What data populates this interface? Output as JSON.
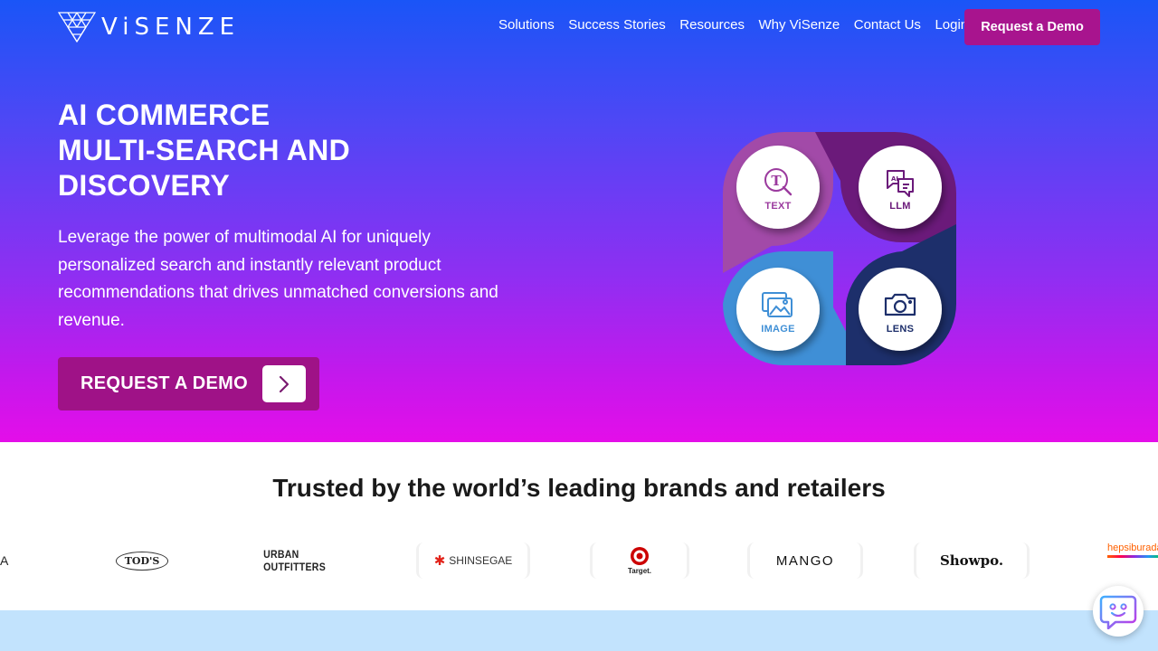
{
  "brand": {
    "name": "ViSENZE"
  },
  "nav": {
    "links": [
      "Solutions",
      "Success Stories",
      "Resources",
      "Why ViSenze",
      "Contact Us",
      "Login"
    ],
    "cta_label": "Request a Demo"
  },
  "hero": {
    "title_lines": [
      "AI COMMERCE",
      "MULTI-SEARCH AND",
      "DISCOVERY"
    ],
    "description": "Leverage the power of multimodal AI for uniquely personalized search and instantly relevant product recommendations that drives unmatched conversions and revenue.",
    "button_label": "REQUEST A DEMO"
  },
  "graphic": {
    "labels": {
      "text": "TEXT",
      "llm": "LLM",
      "image": "IMAGE",
      "lens": "LENS"
    }
  },
  "trusted": {
    "heading": "Trusted by the world’s leading brands and retailers",
    "brands": {
      "partial_left": "A",
      "tods": "TOD'S",
      "urban": "URBAN OUTFITTERS",
      "shinsegae": "SHINSEGAE",
      "target": "Target.",
      "mango": "MANGO",
      "showpo": "Showpo.",
      "hepsiburada": "hepsiburada"
    }
  },
  "colors": {
    "accent": "#a8148e",
    "gradient_top": "#1a55f7",
    "gradient_bottom": "#e40ee9",
    "band": "#c2e3fd"
  }
}
